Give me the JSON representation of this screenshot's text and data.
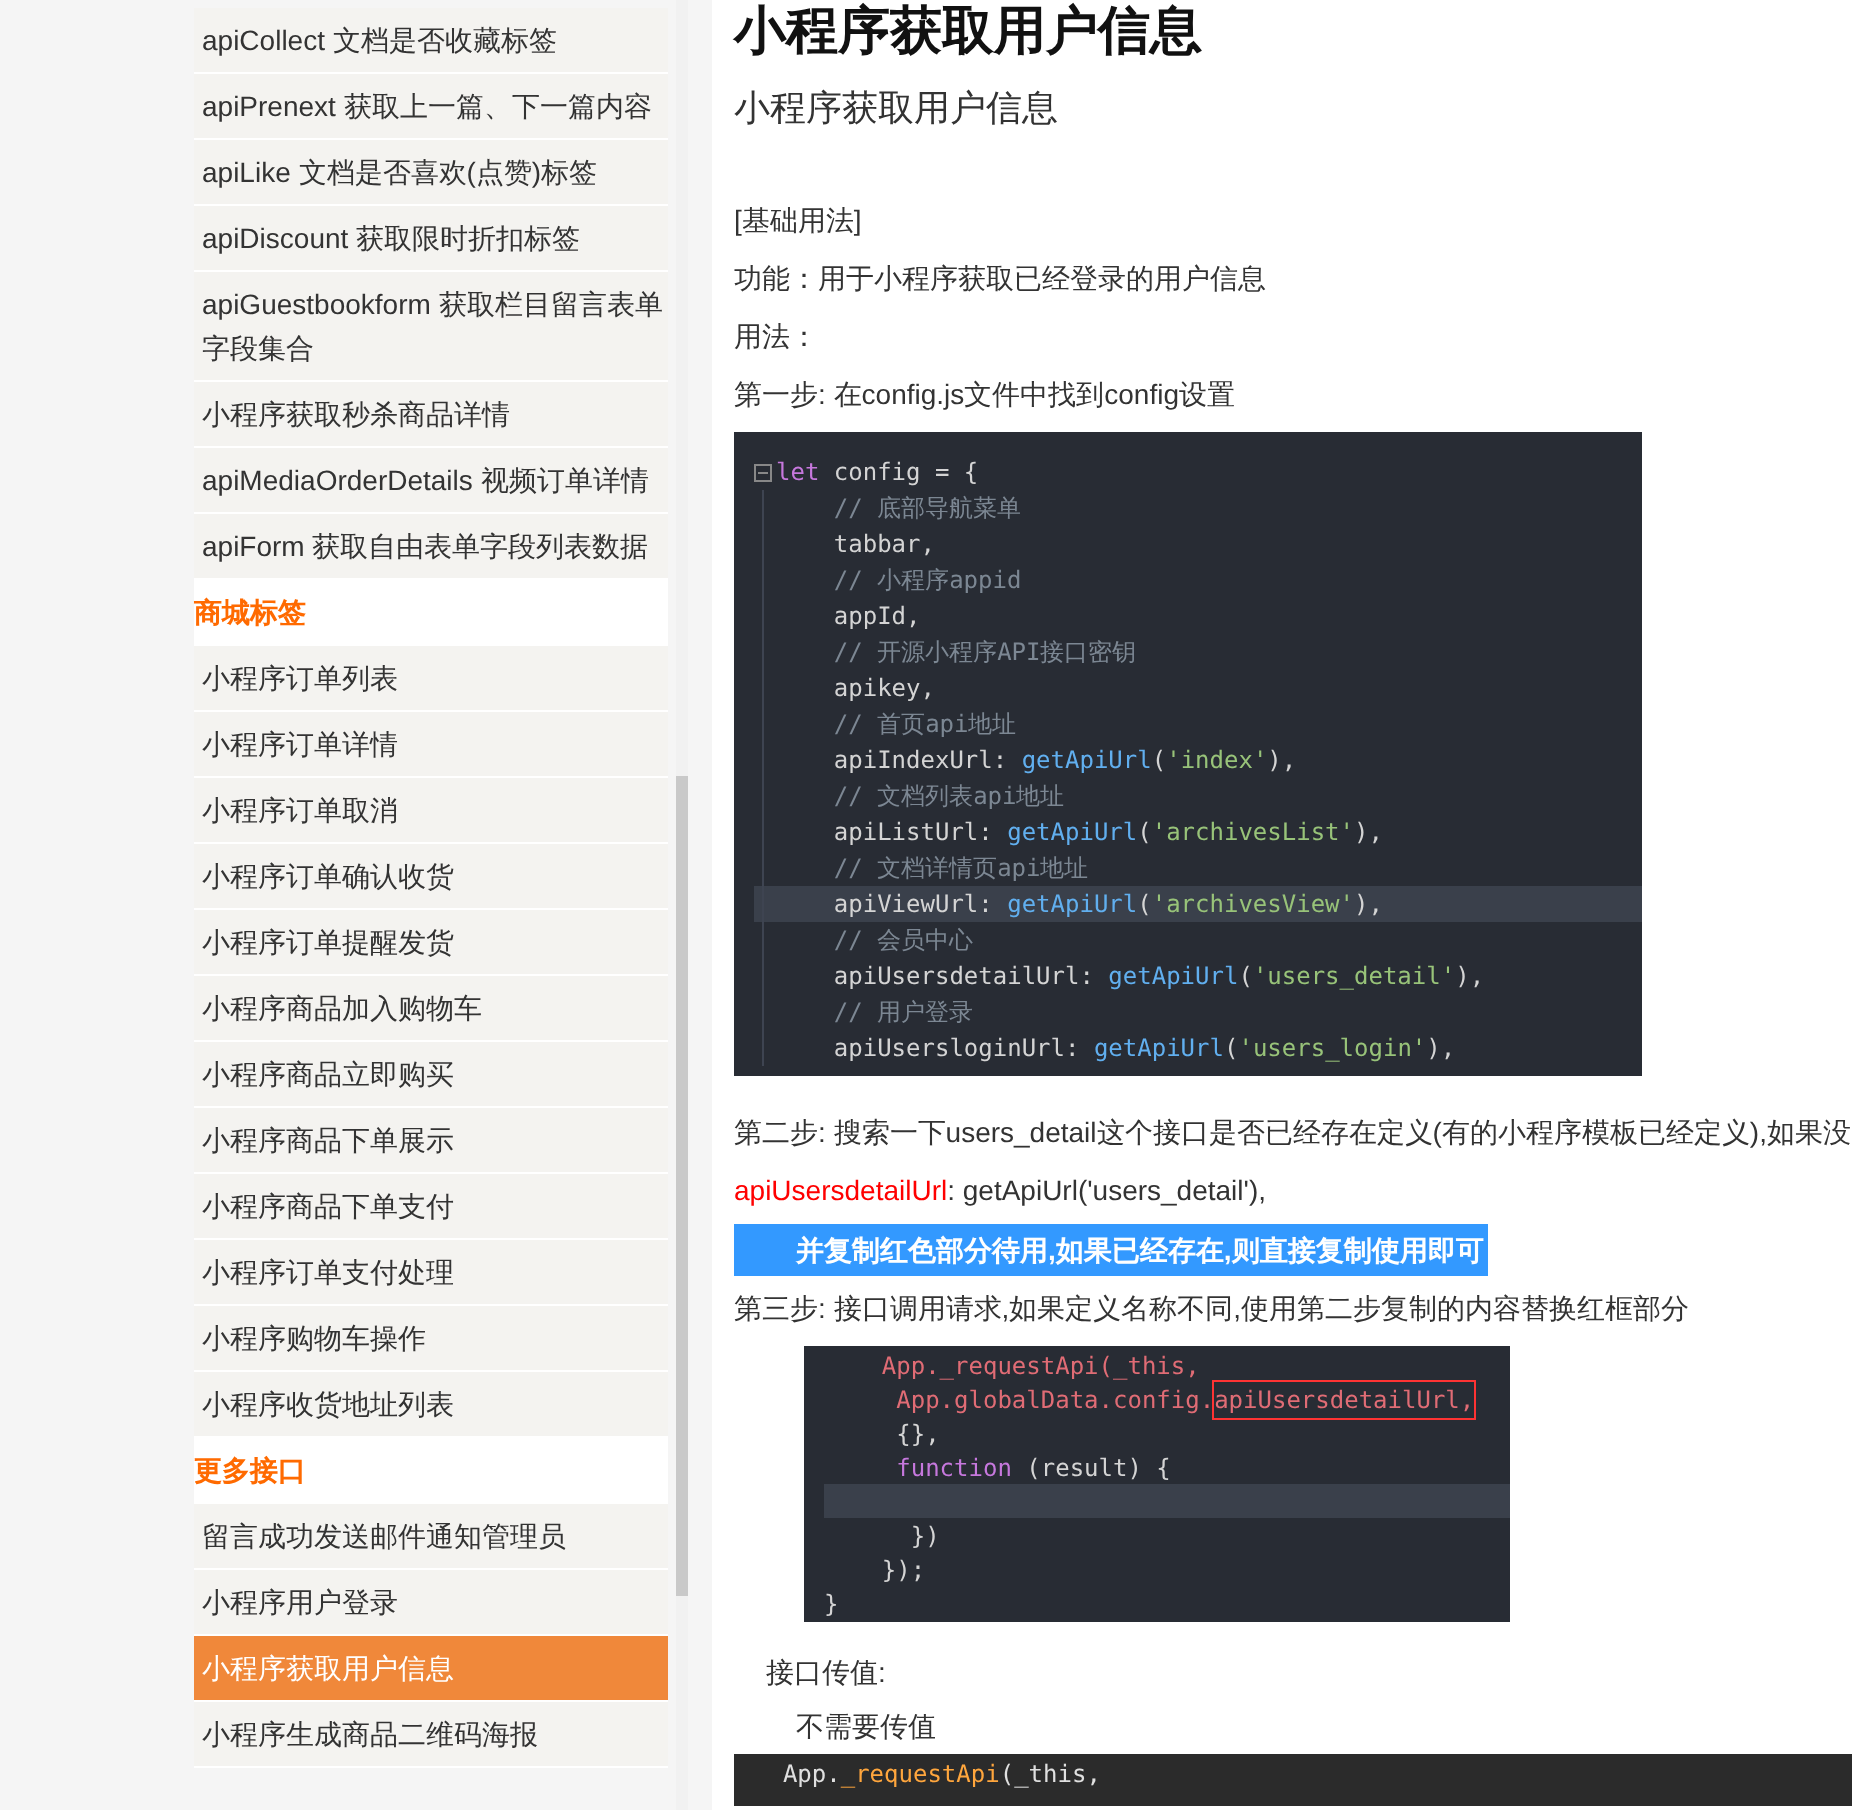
{
  "sidebar": {
    "sections": [
      {
        "items": [
          {
            "label": "apiCollect 文档是否收藏标签",
            "selected": false
          },
          {
            "label": "apiPrenext 获取上一篇、下一篇内容",
            "selected": false
          },
          {
            "label": "apiLike 文档是否喜欢(点赞)标签",
            "selected": false
          },
          {
            "label": "apiDiscount 获取限时折扣标签",
            "selected": false
          },
          {
            "label": "apiGuestbookform 获取栏目留言表单字段集合",
            "selected": false
          },
          {
            "label": "小程序获取秒杀商品详情",
            "selected": false
          },
          {
            "label": "apiMediaOrderDetails 视频订单详情",
            "selected": false
          },
          {
            "label": "apiForm 获取自由表单字段列表数据",
            "selected": false
          }
        ]
      },
      {
        "heading": "商城标签",
        "items": [
          {
            "label": "小程序订单列表",
            "selected": false
          },
          {
            "label": "小程序订单详情",
            "selected": false
          },
          {
            "label": "小程序订单取消",
            "selected": false
          },
          {
            "label": "小程序订单确认收货",
            "selected": false
          },
          {
            "label": "小程序订单提醒发货",
            "selected": false
          },
          {
            "label": "小程序商品加入购物车",
            "selected": false
          },
          {
            "label": "小程序商品立即购买",
            "selected": false
          },
          {
            "label": "小程序商品下单展示",
            "selected": false
          },
          {
            "label": "小程序商品下单支付",
            "selected": false
          },
          {
            "label": "小程序订单支付处理",
            "selected": false
          },
          {
            "label": "小程序购物车操作",
            "selected": false
          },
          {
            "label": "小程序收货地址列表",
            "selected": false
          }
        ]
      },
      {
        "heading": "更多接口",
        "items": [
          {
            "label": "留言成功发送邮件通知管理员",
            "selected": false
          },
          {
            "label": "小程序用户登录",
            "selected": false
          },
          {
            "label": "小程序获取用户信息",
            "selected": true
          },
          {
            "label": "小程序生成商品二维码海报",
            "selected": false
          }
        ]
      }
    ]
  },
  "article": {
    "title": "小程序获取用户信息",
    "subtitle": "小程序获取用户信息",
    "blocks": [
      {
        "kind": "text",
        "text": "[基础用法]"
      },
      {
        "kind": "text",
        "text": "功能：用于小程序获取已经登录的用户信息"
      },
      {
        "kind": "text",
        "text": "用法："
      },
      {
        "kind": "text",
        "text": "第一步: 在config.js文件中找到config设置"
      },
      {
        "kind": "code_editor",
        "lines": [
          {
            "highlighted": false,
            "tokens": [
              {
                "t": "let",
                "kind": "keyword"
              },
              {
                "t": " config = {",
                "kind": "plain"
              }
            ]
          },
          {
            "highlighted": false,
            "tokens": [
              {
                "t": "    // 底部导航菜单",
                "kind": "comment"
              }
            ]
          },
          {
            "highlighted": false,
            "tokens": [
              {
                "t": "    tabbar,",
                "kind": "plain"
              }
            ]
          },
          {
            "highlighted": false,
            "tokens": [
              {
                "t": "    // 小程序appid",
                "kind": "comment"
              }
            ]
          },
          {
            "highlighted": false,
            "tokens": [
              {
                "t": "    appId,",
                "kind": "plain"
              }
            ]
          },
          {
            "highlighted": false,
            "tokens": [
              {
                "t": "    // 开源小程序API接口密钥",
                "kind": "comment"
              }
            ]
          },
          {
            "highlighted": false,
            "tokens": [
              {
                "t": "    apikey,",
                "kind": "plain"
              }
            ]
          },
          {
            "highlighted": false,
            "tokens": [
              {
                "t": "    // 首页api地址",
                "kind": "comment"
              }
            ]
          },
          {
            "highlighted": false,
            "tokens": [
              {
                "t": "    apiIndexUrl: ",
                "kind": "plain"
              },
              {
                "t": "getApiUrl",
                "kind": "func"
              },
              {
                "t": "(",
                "kind": "plain"
              },
              {
                "t": "'index'",
                "kind": "string"
              },
              {
                "t": "),",
                "kind": "plain"
              }
            ]
          },
          {
            "highlighted": false,
            "tokens": [
              {
                "t": "    // 文档列表api地址",
                "kind": "comment"
              }
            ]
          },
          {
            "highlighted": false,
            "tokens": [
              {
                "t": "    apiListUrl: ",
                "kind": "plain"
              },
              {
                "t": "getApiUrl",
                "kind": "func"
              },
              {
                "t": "(",
                "kind": "plain"
              },
              {
                "t": "'archivesList'",
                "kind": "string"
              },
              {
                "t": "),",
                "kind": "plain"
              }
            ]
          },
          {
            "highlighted": false,
            "tokens": [
              {
                "t": "    // 文档详情页api地址",
                "kind": "comment"
              }
            ]
          },
          {
            "highlighted": true,
            "tokens": [
              {
                "t": "    apiViewUrl: ",
                "kind": "plain"
              },
              {
                "t": "getApiUrl",
                "kind": "func"
              },
              {
                "t": "(",
                "kind": "plain"
              },
              {
                "t": "'archivesView'",
                "kind": "string"
              },
              {
                "t": "),",
                "kind": "plain"
              }
            ]
          },
          {
            "highlighted": false,
            "tokens": [
              {
                "t": "    // 会员中心",
                "kind": "comment"
              }
            ]
          },
          {
            "highlighted": false,
            "tokens": [
              {
                "t": "    apiUsersdetailUrl: ",
                "kind": "plain"
              },
              {
                "t": "getApiUrl",
                "kind": "func"
              },
              {
                "t": "(",
                "kind": "plain"
              },
              {
                "t": "'users_detail'",
                "kind": "string"
              },
              {
                "t": "),",
                "kind": "plain"
              }
            ]
          },
          {
            "highlighted": false,
            "tokens": [
              {
                "t": "    // 用户登录",
                "kind": "comment"
              }
            ]
          },
          {
            "highlighted": false,
            "tokens": [
              {
                "t": "    apiUsersloginUrl: ",
                "kind": "plain"
              },
              {
                "t": "getApiUrl",
                "kind": "func"
              },
              {
                "t": "(",
                "kind": "plain"
              },
              {
                "t": "'users_login'",
                "kind": "string"
              },
              {
                "t": "),",
                "kind": "plain"
              }
            ]
          }
        ]
      },
      {
        "kind": "text",
        "text": "第二步: 搜索一下users_detail这个接口是否已经存在定义(有的小程序模板已经定义),如果没"
      },
      {
        "kind": "split",
        "red": "apiUsersdetailUrl",
        "rest": ": getApiUrl('users_detail'),"
      },
      {
        "kind": "highlight",
        "text": "并复制红色部分待用,如果已经存在,则直接复制使用即可"
      },
      {
        "kind": "text",
        "text": "第三步: 接口调用请求,如果定义名称不同,使用第二步复制的内容替换红框部分"
      },
      {
        "kind": "code_inset",
        "lines": [
          {
            "highlighted": false,
            "tokens": [
              {
                "t": "    App._requestApi(_this,",
                "kind": "prop"
              }
            ]
          },
          {
            "highlighted": false,
            "tokens": [
              {
                "t": "     App.globalData.config.",
                "kind": "prop"
              },
              {
                "t": "apiUsersdetailUrl,",
                "kind": "boxed"
              }
            ]
          },
          {
            "highlighted": false,
            "tokens": [
              {
                "t": "     {},",
                "kind": "plain"
              }
            ]
          },
          {
            "highlighted": false,
            "tokens": [
              {
                "t": "     function",
                "kind": "keyword"
              },
              {
                "t": " (result) {",
                "kind": "plain"
              }
            ]
          },
          {
            "highlighted": true
          },
          {
            "highlighted": false,
            "tokens": [
              {
                "t": "      })",
                "kind": "plain"
              }
            ]
          },
          {
            "highlighted": false,
            "tokens": [
              {
                "t": "    });",
                "kind": "plain"
              }
            ]
          },
          {
            "highlighted": false,
            "tokens": [
              {
                "t": "}",
                "kind": "plain"
              }
            ]
          }
        ]
      },
      {
        "kind": "label",
        "text": "接口传值:"
      },
      {
        "kind": "sublabel",
        "text": "不需要传值"
      },
      {
        "kind": "code_dark",
        "lines": [
          {
            "highlighted": false,
            "tokens": [
              {
                "t": "  App.",
                "kind": "plain"
              },
              {
                "t": "_requestApi",
                "kind": "func"
              },
              {
                "t": "(_this,",
                "kind": "plain"
              }
            ]
          }
        ]
      }
    ]
  }
}
